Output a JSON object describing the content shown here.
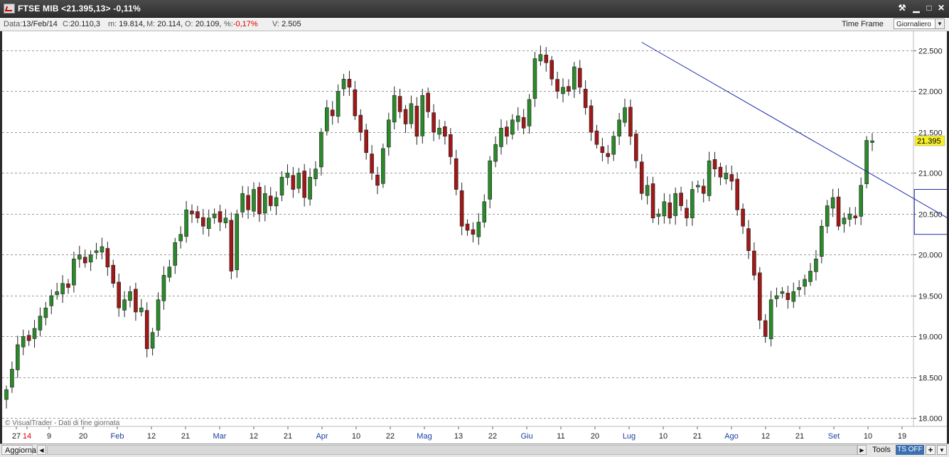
{
  "window": {
    "title": "FTSE MIB <21.395,13> -0,11%",
    "buttons": [
      "⚒",
      "▁",
      "□",
      "✕"
    ]
  },
  "infobar": {
    "data_label": "Data:",
    "data_value": "13/Feb/14",
    "c_label": "C:",
    "c_value": "20.110,3",
    "m_label": "m:",
    "m_value": "19.814,",
    "M_label": "M:",
    "M_value": "20.114,",
    "o_label": "O:",
    "o_value": "20.109,",
    "pct_label": "%:",
    "pct_value": "-0,17%",
    "v_label": "V:",
    "v_value": "2.505",
    "timeframe_label": "Time Frame",
    "timeframe_value": "Giornaliero"
  },
  "bottombar": {
    "aggiorna": "Aggiorna",
    "tools": "Tools",
    "ts": "TS OFF",
    "plus": "+"
  },
  "chart_data": {
    "type": "candlestick",
    "title": "FTSE MIB",
    "watermark": "© VisualTrader - Dati di fine giornata",
    "last_price_label": "21.395",
    "y_ticks": [
      "22.500",
      "22.000",
      "21.500",
      "21.000",
      "20.500",
      "20.000",
      "19.500",
      "19.000",
      "18.500",
      "18.000"
    ],
    "ylim": [
      17.9,
      22.7
    ],
    "x_ticks": [
      {
        "label": "27",
        "color": "#222"
      },
      {
        "label": "14",
        "color": "#d00"
      },
      {
        "label": "9",
        "color": "#222"
      },
      {
        "label": "20",
        "color": "#222"
      },
      {
        "label": "Feb",
        "color": "#1a3fa0"
      },
      {
        "label": "12",
        "color": "#222"
      },
      {
        "label": "21",
        "color": "#222"
      },
      {
        "label": "Mar",
        "color": "#1a3fa0"
      },
      {
        "label": "12",
        "color": "#222"
      },
      {
        "label": "21",
        "color": "#222"
      },
      {
        "label": "Apr",
        "color": "#1a3fa0"
      },
      {
        "label": "10",
        "color": "#222"
      },
      {
        "label": "22",
        "color": "#222"
      },
      {
        "label": "Mag",
        "color": "#1a3fa0"
      },
      {
        "label": "13",
        "color": "#222"
      },
      {
        "label": "22",
        "color": "#222"
      },
      {
        "label": "Giu",
        "color": "#1a3fa0"
      },
      {
        "label": "11",
        "color": "#222"
      },
      {
        "label": "20",
        "color": "#222"
      },
      {
        "label": "Lug",
        "color": "#1a3fa0"
      },
      {
        "label": "10",
        "color": "#222"
      },
      {
        "label": "21",
        "color": "#222"
      },
      {
        "label": "Ago",
        "color": "#1a3fa0"
      },
      {
        "label": "12",
        "color": "#222"
      },
      {
        "label": "21",
        "color": "#222"
      },
      {
        "label": "Set",
        "color": "#1a3fa0"
      },
      {
        "label": "10",
        "color": "#222"
      },
      {
        "label": "19",
        "color": "#222"
      }
    ],
    "closes": [
      18.35,
      18.6,
      18.9,
      19.0,
      18.95,
      19.1,
      19.25,
      19.35,
      19.5,
      19.55,
      19.65,
      19.6,
      19.95,
      20.0,
      19.9,
      20.0,
      20.05,
      20.1,
      19.85,
      19.65,
      19.35,
      19.45,
      19.55,
      19.3,
      19.35,
      18.85,
      19.05,
      19.45,
      19.75,
      19.85,
      20.15,
      20.25,
      20.55,
      20.5,
      20.45,
      20.35,
      20.45,
      20.5,
      20.4,
      20.45,
      19.8,
      20.5,
      20.75,
      20.55,
      20.8,
      20.5,
      20.75,
      20.6,
      20.7,
      20.95,
      21.0,
      20.8,
      21.0,
      20.7,
      20.95,
      21.05,
      21.5,
      21.8,
      21.7,
      22.0,
      22.15,
      22.05,
      21.7,
      21.5,
      21.25,
      21.0,
      20.85,
      21.3,
      21.65,
      21.95,
      21.75,
      21.6,
      21.85,
      21.45,
      21.95,
      21.75,
      21.5,
      21.55,
      21.45,
      21.2,
      20.8,
      20.35,
      20.3,
      20.25,
      20.4,
      20.65,
      21.15,
      21.35,
      21.55,
      21.45,
      21.65,
      21.7,
      21.55,
      21.9,
      22.4,
      22.45,
      22.35,
      22.15,
      22.0,
      22.05,
      22.0,
      22.3,
      22.05,
      21.8,
      21.5,
      21.35,
      21.25,
      21.2,
      21.45,
      21.65,
      21.8,
      21.45,
      21.15,
      20.75,
      20.85,
      20.45,
      20.5,
      20.65,
      20.45,
      20.75,
      20.6,
      20.45,
      20.8,
      20.85,
      20.75,
      21.15,
      21.05,
      20.95,
      21.0,
      20.9,
      20.55,
      20.35,
      20.05,
      19.75,
      19.2,
      19.0,
      19.45,
      19.5,
      19.55,
      19.45,
      19.55,
      19.6,
      19.7,
      19.8,
      19.95,
      20.35,
      20.6,
      20.7,
      20.35,
      20.45,
      20.5,
      20.45,
      20.85,
      21.4,
      21.395
    ],
    "trendline": {
      "from_index": 113,
      "from_value": 22.6,
      "to_index": 175,
      "to_value": 20.15
    }
  }
}
